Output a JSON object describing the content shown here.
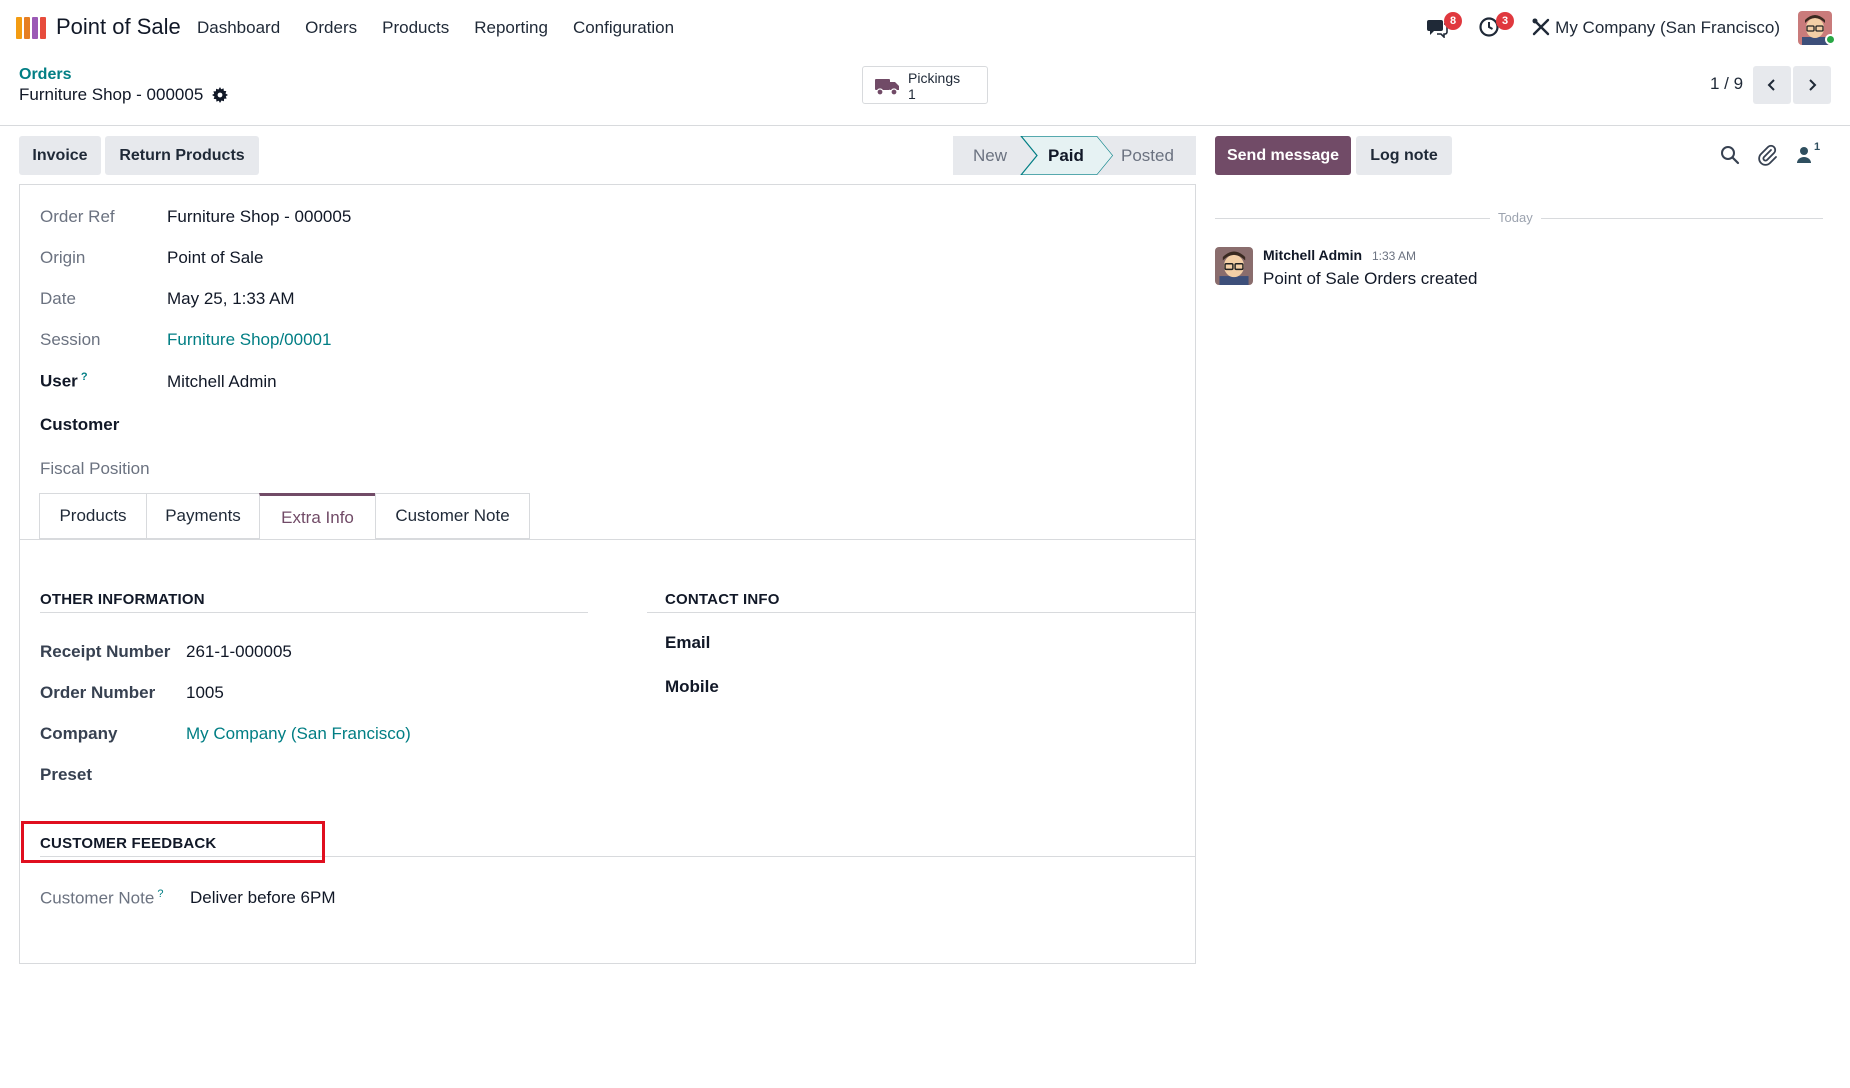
{
  "navbar": {
    "app_name": "Point of Sale",
    "menu": [
      "Dashboard",
      "Orders",
      "Products",
      "Reporting",
      "Configuration"
    ],
    "messages_badge": "8",
    "activities_badge": "3",
    "company": "My Company (San Francisco)"
  },
  "control_panel": {
    "breadcrumb": "Orders",
    "record_title": "Furniture Shop - 000005",
    "smart_button": {
      "label": "Pickings",
      "value": "1"
    },
    "pager": "1 / 9"
  },
  "actions": {
    "invoice": "Invoice",
    "return_products": "Return Products"
  },
  "statusbar": {
    "stages": [
      "New",
      "Paid",
      "Posted"
    ],
    "active": "Paid"
  },
  "form": {
    "order_ref": {
      "label": "Order Ref",
      "value": "Furniture Shop - 000005"
    },
    "origin": {
      "label": "Origin",
      "value": "Point of Sale"
    },
    "date": {
      "label": "Date",
      "value": "May 25, 1:33 AM"
    },
    "session": {
      "label": "Session",
      "value": "Furniture Shop/00001"
    },
    "user": {
      "label": "User",
      "help": "?",
      "value": "Mitchell Admin"
    },
    "customer": {
      "label": "Customer"
    },
    "fiscal_position": {
      "label": "Fiscal Position"
    }
  },
  "tabs": [
    "Products",
    "Payments",
    "Extra Info",
    "Customer Note"
  ],
  "active_tab": "Extra Info",
  "other_info": {
    "title": "OTHER INFORMATION",
    "receipt_number": {
      "label": "Receipt Number",
      "value": "261-1-000005"
    },
    "order_number": {
      "label": "Order Number",
      "value": "1005"
    },
    "company": {
      "label": "Company",
      "value": "My Company (San Francisco)"
    },
    "preset": {
      "label": "Preset"
    }
  },
  "contact_info": {
    "title": "CONTACT INFO",
    "email": "Email",
    "mobile": "Mobile"
  },
  "customer_feedback": {
    "title": "CUSTOMER FEEDBACK",
    "note_label": "Customer Note",
    "note_help": "?",
    "note_value": "Deliver before 6PM"
  },
  "chatter": {
    "send_message": "Send message",
    "log_note": "Log note",
    "followers_count": "1",
    "today": "Today",
    "message": {
      "author": "Mitchell Admin",
      "time": "1:33 AM",
      "body": "Point of Sale Orders created"
    }
  },
  "colors": {
    "brand": "#714b67",
    "link": "#017e84",
    "badge": "#e0383e",
    "highlight": "#e00f1f"
  }
}
